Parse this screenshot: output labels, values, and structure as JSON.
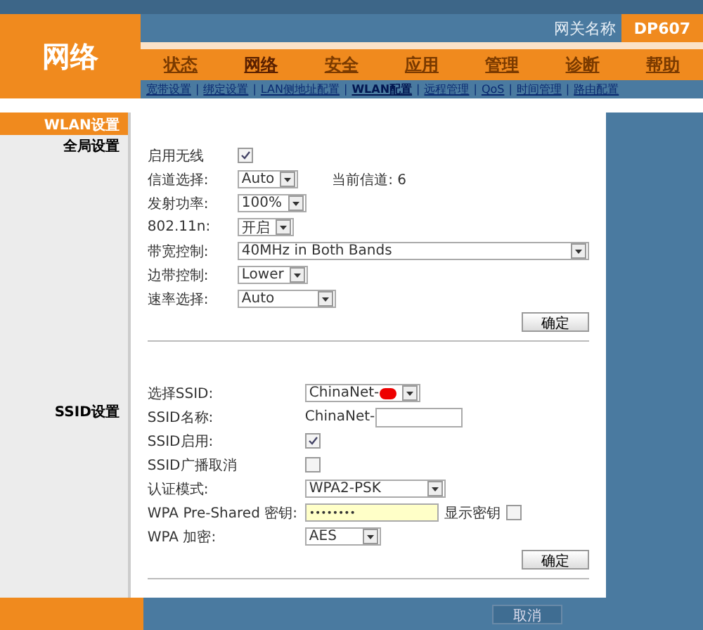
{
  "header": {
    "logo": "网络",
    "gateway_label": "网关名称",
    "gateway_name": "DP607",
    "separator": "|",
    "tabs": [
      {
        "label": "状态",
        "selected": false
      },
      {
        "label": "网络",
        "selected": true
      },
      {
        "label": "安全",
        "selected": false
      },
      {
        "label": "应用",
        "selected": false
      },
      {
        "label": "管理",
        "selected": false
      },
      {
        "label": "诊断",
        "selected": false
      },
      {
        "label": "帮助",
        "selected": false
      }
    ],
    "subtabs": [
      {
        "label": "宽带设置",
        "selected": false
      },
      {
        "label": "绑定设置",
        "selected": false
      },
      {
        "label": "LAN侧地址配置",
        "selected": false
      },
      {
        "label": "WLAN配置",
        "selected": true
      },
      {
        "label": "远程管理",
        "selected": false
      },
      {
        "label": "QoS",
        "selected": false
      },
      {
        "label": "时间管理",
        "selected": false
      },
      {
        "label": "路由配置",
        "selected": false
      }
    ]
  },
  "sidebar": {
    "items": [
      {
        "label": "WLAN设置",
        "selected": true
      }
    ]
  },
  "sections": [
    {
      "title": "全局设置",
      "button": "确定",
      "rows": [
        {
          "kind": "checkbox",
          "label": "启用无线",
          "checked": true
        },
        {
          "kind": "select",
          "label": "信道选择:",
          "value": "Auto",
          "note": "当前信道: 6"
        },
        {
          "kind": "select",
          "label": "发射功率:",
          "value": "100%"
        },
        {
          "kind": "select",
          "label": "802.11n:",
          "value": "开启"
        },
        {
          "kind": "select",
          "label": "带宽控制:",
          "value": "40MHz in Both Bands"
        },
        {
          "kind": "select",
          "label": "边带控制:",
          "value": "Lower"
        },
        {
          "kind": "select",
          "label": "速率选择:",
          "value": "Auto"
        }
      ]
    },
    {
      "title": "SSID设置",
      "button": "确定",
      "rows": [
        {
          "kind": "select",
          "label": "选择SSID:",
          "value": "ChinaNet-",
          "redacted": true
        },
        {
          "kind": "text",
          "label": "SSID名称:",
          "prefix": "ChinaNet-"
        },
        {
          "kind": "checkbox",
          "label": "SSID启用:",
          "checked": true
        },
        {
          "kind": "checkbox",
          "label": "SSID广播取消",
          "checked": false
        },
        {
          "kind": "select",
          "label": "认证模式:",
          "value": "WPA2-PSK"
        },
        {
          "kind": "password",
          "label": "WPA Pre-Shared 密钥:",
          "value": "••••••••",
          "show_label": "显示密钥",
          "show_checked": false
        },
        {
          "kind": "select",
          "label": "WPA 加密:",
          "value": "AES"
        }
      ]
    }
  ],
  "footer": {
    "button": "取消"
  }
}
